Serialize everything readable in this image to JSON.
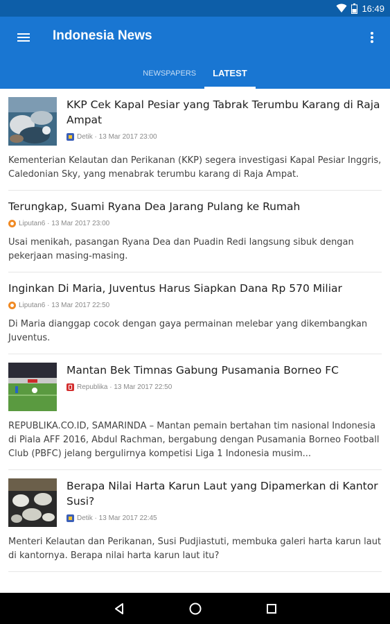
{
  "status_bar": {
    "time": "16:49"
  },
  "app_bar": {
    "title": "Indonesia News",
    "tabs": [
      {
        "label": "NEWSPAPERS",
        "active": false
      },
      {
        "label": "LATEST",
        "active": true
      }
    ]
  },
  "articles": [
    {
      "headline": "KKP Cek Kapal Pesiar yang Tabrak Terumbu Karang di Raja Ampat",
      "source": "Detik",
      "timestamp": "13 Mar 2017 23:00",
      "meta": "Detik · 13 Mar 2017 23:00",
      "summary": "Kementerian Kelautan dan Perikanan (KKP) segera investigasi Kapal Pesiar Inggris, Caledonian Sky, yang menabrak terumbu karang di Raja Ampat.",
      "source_icon": "detik-icon",
      "thumbnail": "coral-reef-image"
    },
    {
      "headline": "Terungkap, Suami Ryana Dea Jarang Pulang ke Rumah",
      "source": "Liputan6",
      "timestamp": "13 Mar 2017 23:00",
      "meta": "Liputan6 · 13 Mar 2017 23:00",
      "summary": "Usai menikah, pasangan Ryana Dea dan Puadin Redi langsung sibuk dengan pekerjaan masing-masing.",
      "source_icon": "liputan6-icon"
    },
    {
      "headline": "Inginkan Di Maria, Juventus Harus Siapkan Dana Rp 570 Miliar",
      "source": "Liputan6",
      "timestamp": "13 Mar 2017 22:50",
      "meta": "Liputan6 · 13 Mar 2017 22:50",
      "summary": "Di Maria dianggap cocok dengan gaya permainan melebar yang dikembangkan Juventus.",
      "source_icon": "liputan6-icon"
    },
    {
      "headline": "Mantan Bek Timnas Gabung Pusamania Borneo FC",
      "source": "Republika",
      "timestamp": "13 Mar 2017 22:50",
      "meta": "Republika · 13 Mar 2017 22:50",
      "summary": "REPUBLIKA.CO.ID, SAMARINDA – Mantan pemain bertahan tim nasional Indonesia di Piala AFF 2016, Abdul Rachman, bergabung dengan Pusamania Borneo Football Club (PBFC) jelang bergulirnya kompetisi Liga 1 Indonesia musim...",
      "source_icon": "republika-icon",
      "thumbnail": "football-field-image"
    },
    {
      "headline": "Berapa Nilai Harta Karun Laut yang Dipamerkan di Kantor Susi?",
      "source": "Detik",
      "timestamp": "13 Mar 2017 22:45",
      "meta": "Detik · 13 Mar 2017 22:45",
      "summary": "Menteri Kelautan dan Perikanan, Susi Pudjiastuti, membuka galeri harta karun laut di kantornya. Berapa nilai harta karun laut itu?",
      "source_icon": "detik-icon",
      "thumbnail": "ceramics-treasure-image"
    }
  ],
  "colors": {
    "status_bar": "#0d5ea8",
    "app_bar": "#1976d2",
    "nav_bar": "#000000",
    "detik": "#3b5fb8",
    "liputan6": "#f08a24",
    "republika": "#d32f2f"
  }
}
